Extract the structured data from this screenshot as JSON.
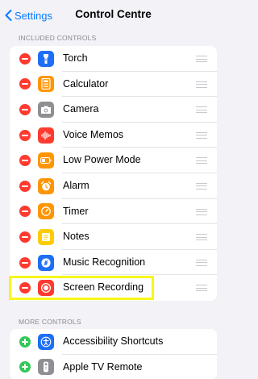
{
  "nav": {
    "back_label": "Settings",
    "title": "Control Centre"
  },
  "sections": {
    "included_header": "INCLUDED CONTROLS",
    "more_header": "MORE CONTROLS"
  },
  "included": [
    {
      "label": "Torch",
      "icon": "torch-icon",
      "color": "#1e6ff5"
    },
    {
      "label": "Calculator",
      "icon": "calculator-icon",
      "color": "#ff9500"
    },
    {
      "label": "Camera",
      "icon": "camera-icon",
      "color": "#8e8e93"
    },
    {
      "label": "Voice Memos",
      "icon": "voice-memos-icon",
      "color": "#ff3b30"
    },
    {
      "label": "Low Power Mode",
      "icon": "battery-icon",
      "color": "#ff9500"
    },
    {
      "label": "Alarm",
      "icon": "alarm-icon",
      "color": "#ff9500"
    },
    {
      "label": "Timer",
      "icon": "timer-icon",
      "color": "#ff9500"
    },
    {
      "label": "Notes",
      "icon": "notes-icon",
      "color": "#ffcc00"
    },
    {
      "label": "Music Recognition",
      "icon": "shazam-icon",
      "color": "#1e6ff5"
    },
    {
      "label": "Screen Recording",
      "icon": "screen-recording-icon",
      "color": "#ff3b30"
    }
  ],
  "more": [
    {
      "label": "Accessibility Shortcuts",
      "icon": "accessibility-icon",
      "color": "#1e6ff5"
    },
    {
      "label": "Apple TV Remote",
      "icon": "remote-icon",
      "color": "#8e8e93"
    }
  ]
}
